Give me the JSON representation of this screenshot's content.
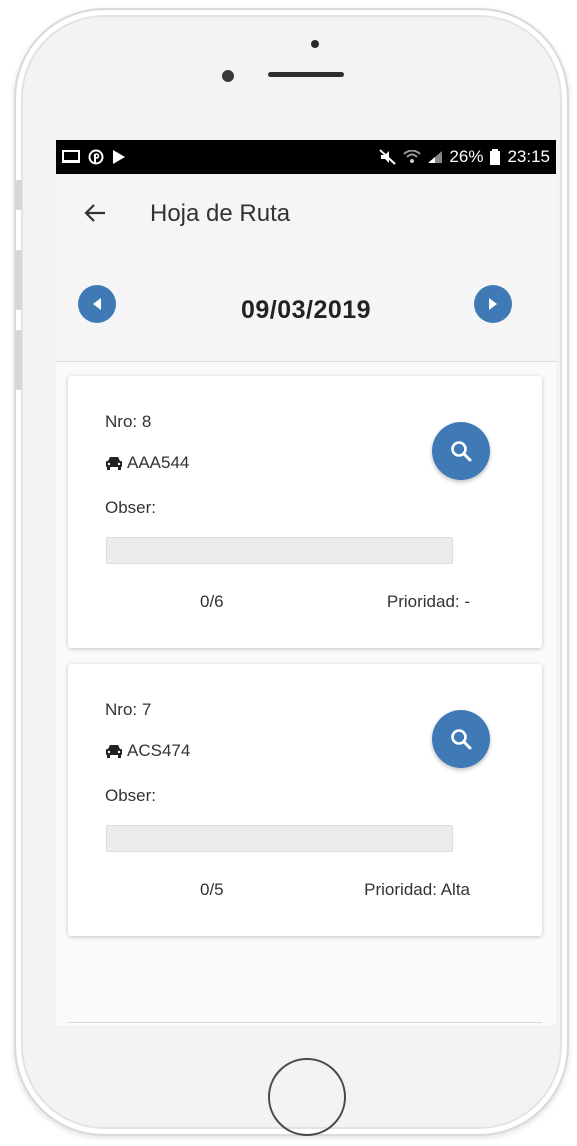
{
  "status_bar": {
    "left_icons": [
      "cast-icon",
      "pinterest-icon",
      "play-store-icon"
    ],
    "battery": "26%",
    "time": "23:15"
  },
  "toolbar": {
    "back_icon": "arrow-left-icon",
    "title": "Hoja de Ruta"
  },
  "date_nav": {
    "date": "09/03/2019",
    "prev_icon": "chevron-left-circle-icon",
    "next_icon": "chevron-right-circle-icon"
  },
  "cards": [
    {
      "nro": "Nro: 8",
      "plate": "AAA544",
      "obser_label": "Obser:",
      "obser_value": "",
      "progress": "0/6",
      "prioridad": "Prioridad: -"
    },
    {
      "nro": "Nro: 7",
      "plate": "ACS474",
      "obser_label": "Obser:",
      "obser_value": "",
      "progress": "0/5",
      "prioridad": "Prioridad: Alta"
    }
  ],
  "colors": {
    "accent": "#3f7ab6",
    "status_bar": "#000000",
    "toolbar_bg": "#f5f5f5"
  }
}
